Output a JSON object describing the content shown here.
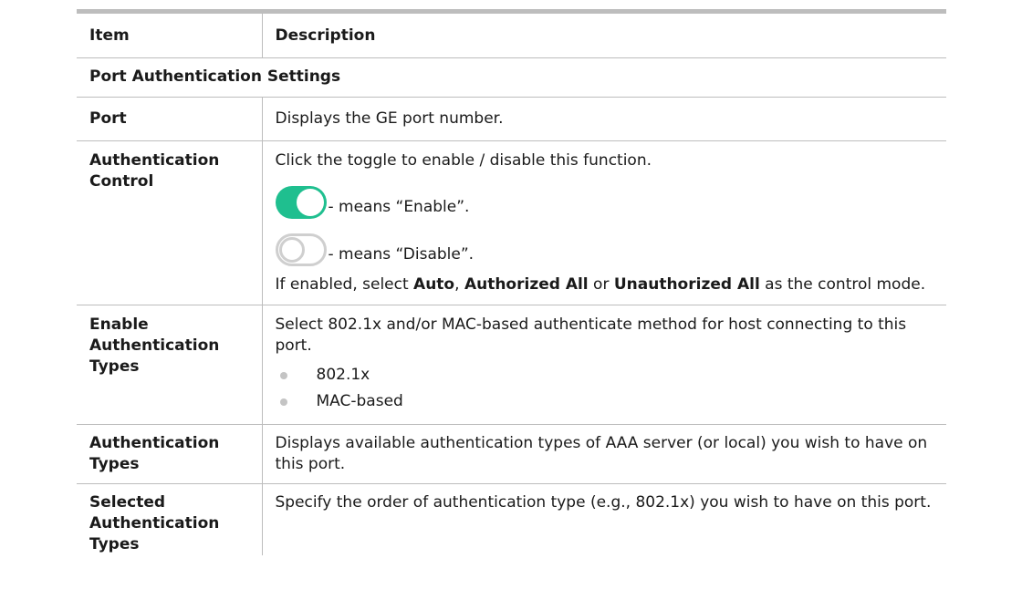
{
  "header": {
    "item": "Item",
    "description": "Description"
  },
  "section": {
    "title": "Port Authentication Settings"
  },
  "rows": {
    "port": {
      "item": "Port",
      "description": "Displays the GE port number."
    },
    "auth_control": {
      "item": "Authentication Control",
      "intro": "Click the toggle to enable / disable this function.",
      "enable_text": "- means “Enable”.",
      "disable_text": "- means “Disable”.",
      "note_pre": "If enabled, select ",
      "note_auto": "Auto",
      "note_sep1": ", ",
      "note_authorized": "Authorized All",
      "note_or": " or ",
      "note_unauthorized": "Unauthorized All",
      "note_post": " as the control mode."
    },
    "enable_types": {
      "item": "Enable Authentication Types",
      "description": "Select 802.1x and/or MAC-based authenticate method for host connecting to this port.",
      "bullets": [
        "802.1x",
        "MAC-based"
      ]
    },
    "auth_types": {
      "item": "Authentication Types",
      "description": "Displays available authentication types of AAA server (or local) you wish to have on this port."
    },
    "selected_types": {
      "item": "Selected Authentication Types",
      "description": "Specify the order of authentication type (e.g., 802.1x) you wish to have on this port."
    }
  },
  "colors": {
    "toggle_on": "#1fbf8f",
    "toggle_off_border": "#cfcfcf",
    "rule": "#bdbdbd"
  },
  "icons": {
    "enable": "toggle-on-icon",
    "disable": "toggle-off-icon",
    "bullet": "bullet-dot-icon"
  }
}
